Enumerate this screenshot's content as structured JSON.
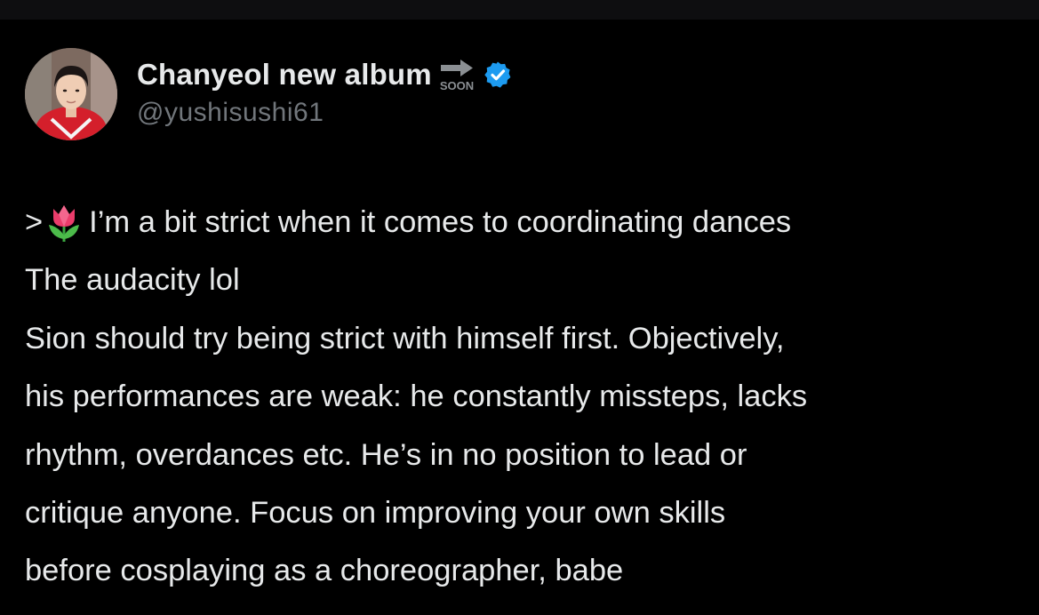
{
  "post": {
    "author": {
      "display_name": "Chanyeol new album",
      "name_emoji": "soon-arrow-icon",
      "verified": true,
      "handle": "@yushisushi61"
    },
    "quote_marker": ">",
    "quote_emoji": "tulip-icon",
    "lines": [
      "I’m a bit strict when it comes to coordinating dances",
      "The audacity lol",
      "Sion should try being strict with himself first. Objectively,",
      "his performances are weak: he constantly missteps, lacks",
      "rhythm, overdances etc. He’s in no position to lead or",
      "critique anyone. Focus on improving your own skills",
      "before cosplaying as a choreographer, babe"
    ]
  },
  "colors": {
    "background": "#000000",
    "text": "#e7e9ea",
    "secondary_text": "#71767b",
    "verified_blue": "#1d9bf0"
  }
}
